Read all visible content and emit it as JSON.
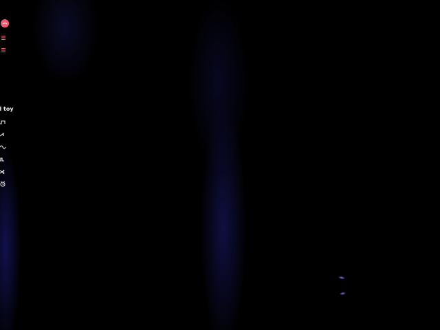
{
  "toy": {
    "title": "ol toy"
  },
  "colors": {
    "accent": "#f05a6f",
    "background": "#000000",
    "glow": "#1f1f8c",
    "text": "#f0f0f0"
  },
  "icons": {
    "brand": "brand-logo-icon",
    "menu": "hamburger-icon",
    "waves": [
      "square-wave-icon",
      "sawtooth-wave-icon",
      "sine-wave-icon",
      "pulse-wave-icon",
      "shuffle-icon",
      "alarm-clock-icon"
    ]
  }
}
